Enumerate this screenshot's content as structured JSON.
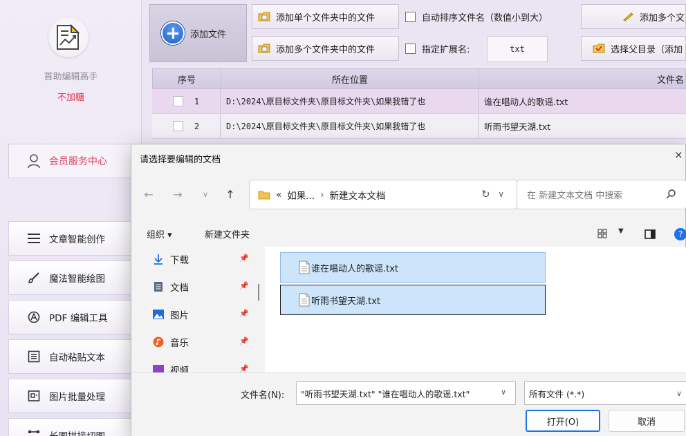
{
  "sidebar": {
    "app_name": "首助编辑高手",
    "status": "不加糖",
    "member_label": "会员服务中心",
    "items": [
      {
        "label": "文章智能创作",
        "icon": "menu-lines-icon"
      },
      {
        "label": "魔法智能绘图",
        "icon": "brush-icon"
      },
      {
        "label": "PDF 编辑工具",
        "icon": "pdf-icon"
      },
      {
        "label": "自动粘贴文本",
        "icon": "text-box-icon"
      },
      {
        "label": "图片批量处理",
        "icon": "image-frame-icon"
      },
      {
        "label": "长图拼接切图",
        "icon": "stitch-icon"
      }
    ]
  },
  "toolbar": {
    "add_file": "添加文件",
    "add_single_folder": "添加单个文件夹中的文件",
    "add_multi_folder": "添加多个文件夹中的文件",
    "auto_sort": "自动排序文件名（数值小到大）",
    "specify_ext": "指定扩展名:",
    "ext_value": "txt",
    "add_multi_files": "添加多个文",
    "select_parent": "选择父目录（添加"
  },
  "table": {
    "headers": [
      "序号",
      "所在位置",
      "文件名"
    ],
    "rows": [
      {
        "no": "1",
        "location": "D:\\2024\\原目标文件夹\\原目标文件夹\\如果我错了也",
        "name": "谁在唱动人的歌谣.txt"
      },
      {
        "no": "2",
        "location": "D:\\2024\\原目标文件夹\\原目标文件夹\\如果我错了也",
        "name": "听雨书望天湖.txt"
      }
    ]
  },
  "dialog": {
    "title": "请选择要编辑的文档",
    "close": "×",
    "address": {
      "prefix": "«",
      "parent": "如果...",
      "current": "新建文本文档"
    },
    "search_placeholder": "在 新建文本文档 中搜索",
    "organize": "组织 ▾",
    "new_folder": "新建文件夹",
    "nav_items": [
      {
        "label": "下载",
        "icon": "download-icon"
      },
      {
        "label": "文档",
        "icon": "document-icon"
      },
      {
        "label": "图片",
        "icon": "pictures-icon"
      },
      {
        "label": "音乐",
        "icon": "music-icon"
      },
      {
        "label": "视频",
        "icon": "video-icon"
      }
    ],
    "files": [
      "谁在唱动人的歌谣.txt",
      "听雨书望天湖.txt"
    ],
    "filename_label": "文件名(N):",
    "filename_value": "\"听雨书望天湖.txt\" \"谁在唱动人的歌谣.txt\"",
    "filter_value": "所有文件 (*.*)",
    "open_label": "打开(O)",
    "cancel_label": "取消"
  },
  "colors": {
    "accent": "#1a73e8",
    "member": "#e0405a",
    "status": "#e0304b"
  }
}
